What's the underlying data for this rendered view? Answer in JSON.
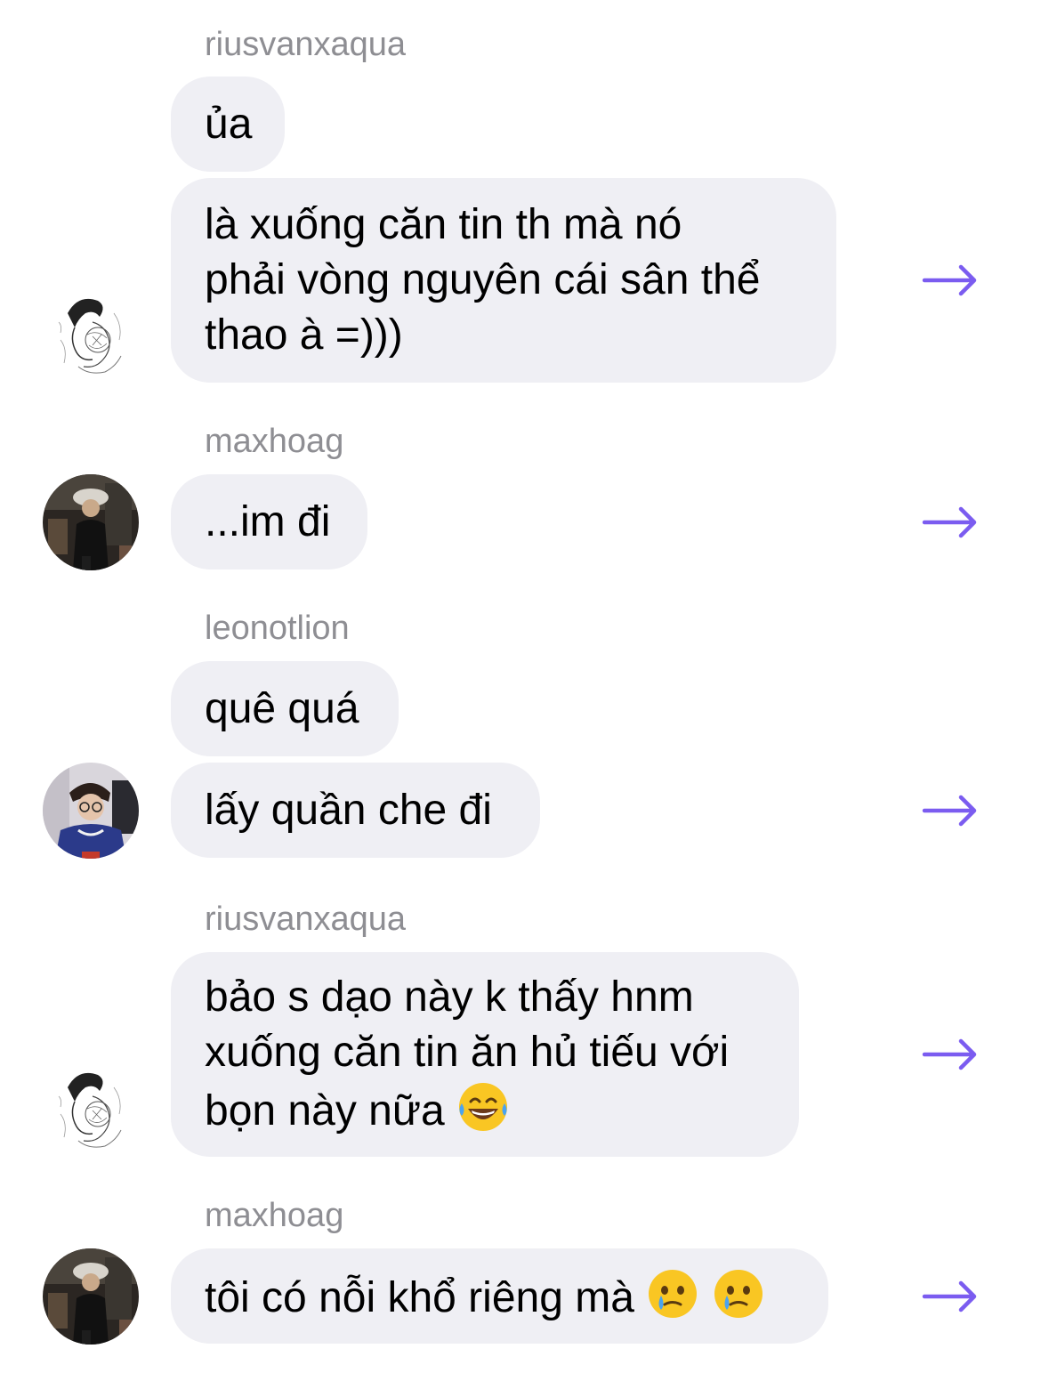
{
  "groups": [
    {
      "sender": "riusvanxaqua",
      "avatar": "sketch-avatar",
      "messages": [
        "ủa",
        "là xuống căn tin th mà nó\nphải vòng nguyên cái sân thể\nthao à =)))"
      ]
    },
    {
      "sender": "maxhoag",
      "avatar": "photo-avatar-hat",
      "messages": [
        "...im đi"
      ]
    },
    {
      "sender": "leonotlion",
      "avatar": "photo-avatar-glasses",
      "messages": [
        "quê quá",
        "lấy quần che đi"
      ]
    },
    {
      "sender": "riusvanxaqua",
      "avatar": "sketch-avatar",
      "messages": [
        "bảo s dạo này k thấy hnm\nxuống căn tin ăn hủ tiếu với\nbọn này nữa"
      ]
    },
    {
      "sender": "maxhoag",
      "avatar": "photo-avatar-hat",
      "messages": [
        "tôi có nỗi khổ riêng mà"
      ]
    }
  ],
  "icons": {
    "forward": "forward-arrow-icon",
    "laughing": "tears-of-joy-emoji",
    "crying": "holding-back-tears-emoji"
  },
  "colors": {
    "bubble": "#efeff4",
    "sender": "#8e8e93",
    "forward_arrow": "#7b5cf0"
  }
}
